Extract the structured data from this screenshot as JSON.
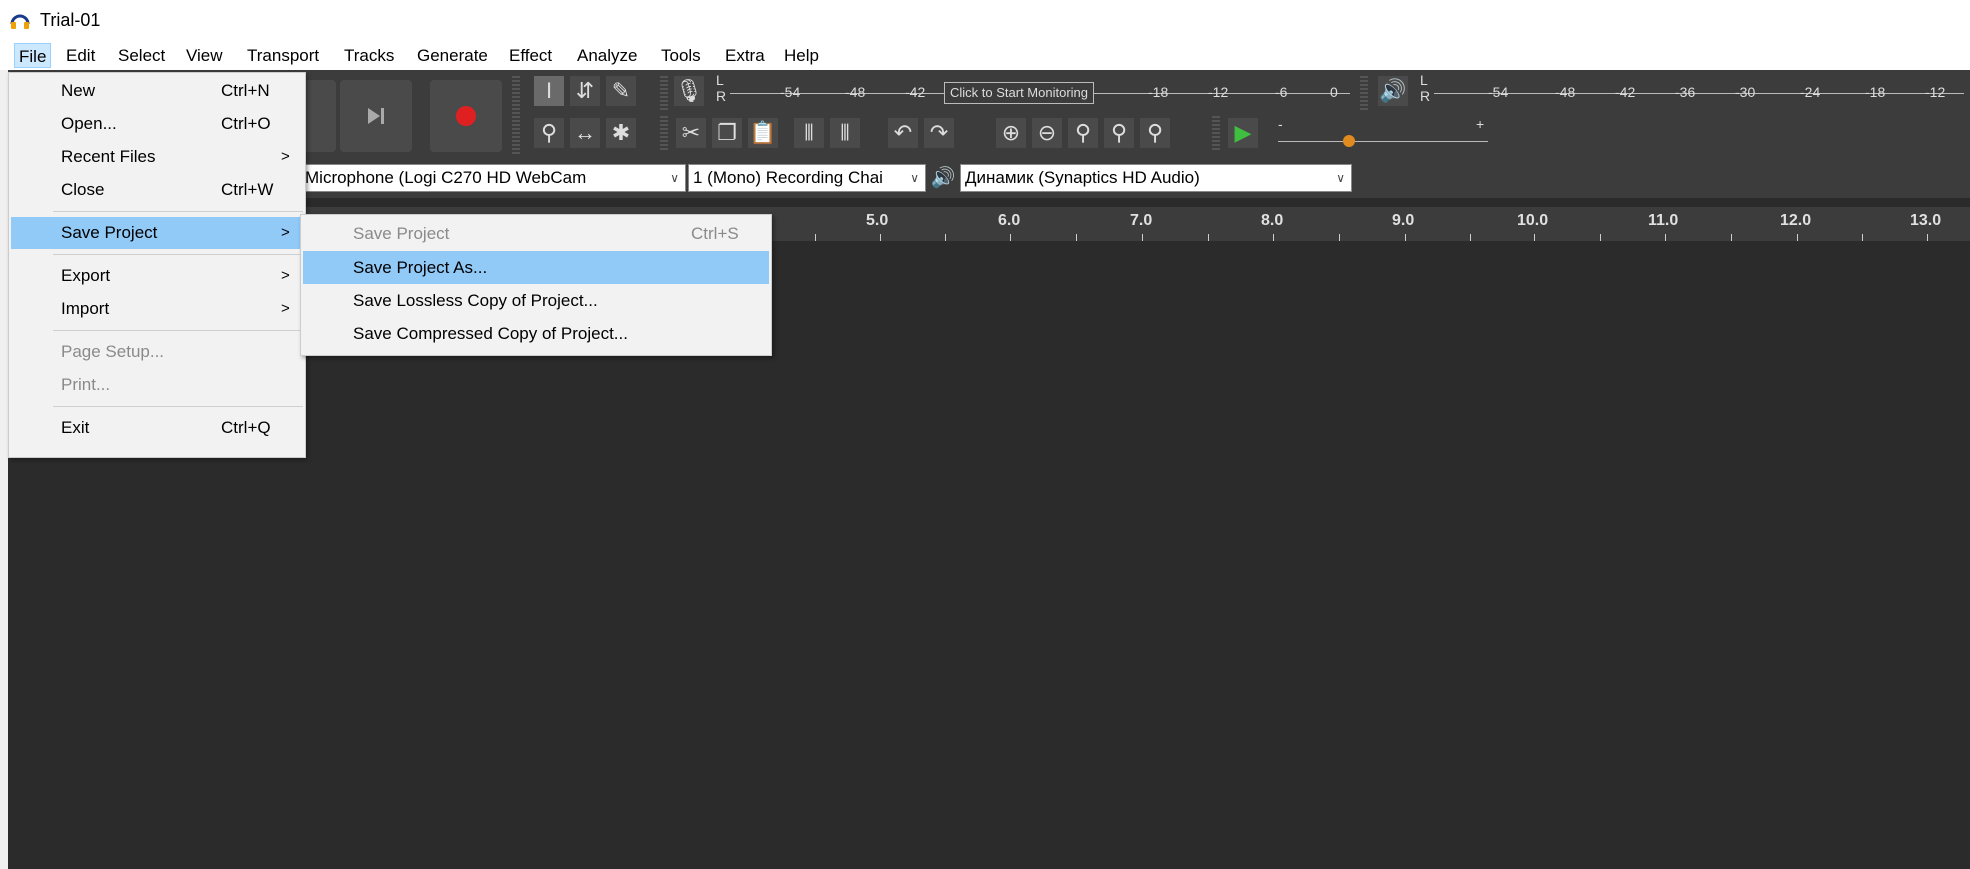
{
  "window": {
    "title": "Trial-01",
    "icon": "headphones-icon"
  },
  "menubar": {
    "items": [
      {
        "label": "File",
        "active": true
      },
      {
        "label": "Edit"
      },
      {
        "label": "Select"
      },
      {
        "label": "View"
      },
      {
        "label": "Transport"
      },
      {
        "label": "Tracks"
      },
      {
        "label": "Generate"
      },
      {
        "label": "Effect"
      },
      {
        "label": "Analyze"
      },
      {
        "label": "Tools"
      },
      {
        "label": "Extra"
      },
      {
        "label": "Help"
      }
    ]
  },
  "file_menu": {
    "items": [
      {
        "label": "New",
        "shortcut": "Ctrl+N"
      },
      {
        "label": "Open...",
        "shortcut": "Ctrl+O"
      },
      {
        "label": "Recent Files",
        "arrow": ">"
      },
      {
        "label": "Close",
        "shortcut": "Ctrl+W"
      },
      {
        "label": "Save Project",
        "arrow": ">",
        "highlighted": true
      },
      {
        "label": "Export",
        "arrow": ">"
      },
      {
        "label": "Import",
        "arrow": ">"
      },
      {
        "label": "Page Setup...",
        "disabled": true
      },
      {
        "label": "Print...",
        "disabled": true
      },
      {
        "label": "Exit",
        "shortcut": "Ctrl+Q"
      }
    ]
  },
  "save_submenu": {
    "items": [
      {
        "label": "Save Project",
        "shortcut": "Ctrl+S",
        "disabled": true
      },
      {
        "label": "Save Project As...",
        "highlighted": true
      },
      {
        "label": "Save Lossless Copy of Project..."
      },
      {
        "label": "Save Compressed Copy of Project..."
      }
    ]
  },
  "meters": {
    "record": {
      "ticks": [
        "-54",
        "-48",
        "-42",
        "-18",
        "-12",
        "-6",
        "0"
      ],
      "channels": [
        "L",
        "R"
      ],
      "monitor_label": "Click to Start Monitoring"
    },
    "playback": {
      "ticks": [
        "-54",
        "-48",
        "-42",
        "-36",
        "-30",
        "-24",
        "-18",
        "-12"
      ],
      "channels": [
        "L",
        "R"
      ]
    }
  },
  "playback_speed": {
    "minus": "-",
    "plus": "+"
  },
  "devices": {
    "recording_device": "Microphone (Logi C270 HD WebCam",
    "recording_channels": "1 (Mono) Recording Chai",
    "playback_device": "Динамик (Synaptics HD Audio)"
  },
  "ruler": {
    "labels": [
      "5.0",
      "6.0",
      "7.0",
      "8.0",
      "9.0",
      "10.0",
      "11.0",
      "12.0",
      "13.0"
    ]
  },
  "colors": {
    "highlight": "#91c9f7",
    "background": "#2b2b2b",
    "toolbar": "#3c3c3c",
    "record": "#e02020",
    "play": "#3fbf3f"
  }
}
